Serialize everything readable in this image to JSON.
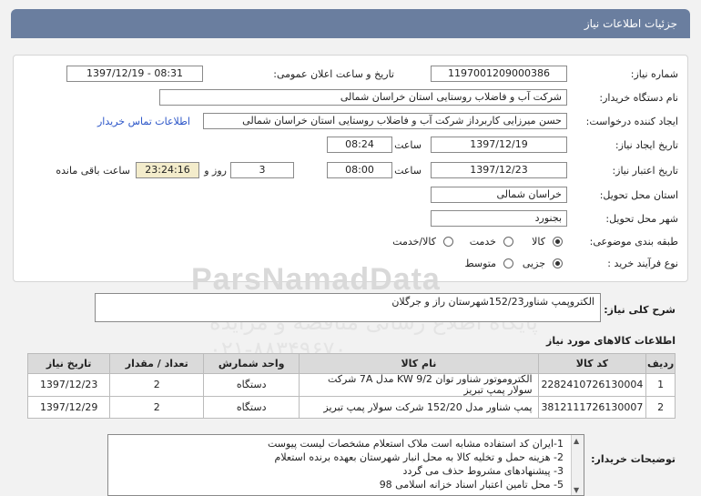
{
  "header": {
    "title": "جزئیات اطلاعات نیاز"
  },
  "form": {
    "need_number_label": "شماره نیاز:",
    "need_number": "1197001209000386",
    "announce_label": "تاریخ و ساعت اعلان عمومی:",
    "announce_value": "1397/12/19 - 08:31",
    "buyer_label": "نام دستگاه خریدار:",
    "buyer_value": "شرکت آب و فاضلاب روستایی استان خراسان شمالی",
    "creator_label": "ایجاد کننده درخواست:",
    "creator_value": "حسن  میرزایی کاربرداز شرکت آب و فاضلاب روستایی استان خراسان شمالی",
    "contact_link": "اطلاعات تماس خریدار",
    "created_label": "تاریخ ایجاد نیاز:",
    "created_date": "1397/12/19",
    "time_label": "ساعت",
    "created_time": "08:24",
    "valid_label": "تاریخ اعتبار نیاز:",
    "valid_date": "1397/12/23",
    "valid_time": "08:00",
    "days_value": "3",
    "days_label": "روز و",
    "remaining_value": "23:24:16",
    "remaining_label": "ساعت باقی مانده",
    "province_label": "استان محل تحویل:",
    "province_value": "خراسان شمالی",
    "city_label": "شهر محل تحویل:",
    "city_value": "بجنورد",
    "category_label": "طبقه بندی موضوعی:",
    "category_options": [
      "کالا",
      "خدمت",
      "کالا/خدمت"
    ],
    "process_label": "نوع فرآیند خرید :",
    "process_options": [
      "جزیی",
      "متوسط"
    ]
  },
  "watermark": {
    "brand": "ParsNamadData",
    "line1": "پایگاه اطلاع رسانی مناقصه و مزایده",
    "line2": "۰۲۱-۸۸۳۴۹۶۷۰"
  },
  "description": {
    "label": "شرح کلی نیاز:",
    "value": "الکتروپمپ شناور152/23شهرستان راز و جرگلان"
  },
  "goods": {
    "title": "اطلاعات کالاهای مورد نیاز",
    "headers": [
      "ردیف",
      "کد کالا",
      "نام کالا",
      "واحد شمارش",
      "تعداد / مقدار",
      "تاریخ نیاز"
    ],
    "rows": [
      [
        "1",
        "2282410726130004",
        "الکتروموتور شناور توان KW 9/2 مدل 7A شرکت سولار پمپ تبریز",
        "دستگاه",
        "2",
        "1397/12/23"
      ],
      [
        "2",
        "3812111726130007",
        "پمپ شناور مدل 152/20 شرکت سولار پمپ تبریز",
        "دستگاه",
        "2",
        "1397/12/29"
      ]
    ]
  },
  "buyer_notes": {
    "label": "توضیحات خریدار:",
    "lines": [
      "1-ایران کد استفاده مشابه است ملاک استعلام مشخصات لیست پیوست",
      "2- هزینه حمل و تخلیه کالا به محل انبار شهرستان  بعهده برنده استعلام",
      "3- پیشنهادهای مشروط حذف می گردد",
      "5- محل تامین اعتبار اسناد خزانه اسلامی  98"
    ]
  }
}
